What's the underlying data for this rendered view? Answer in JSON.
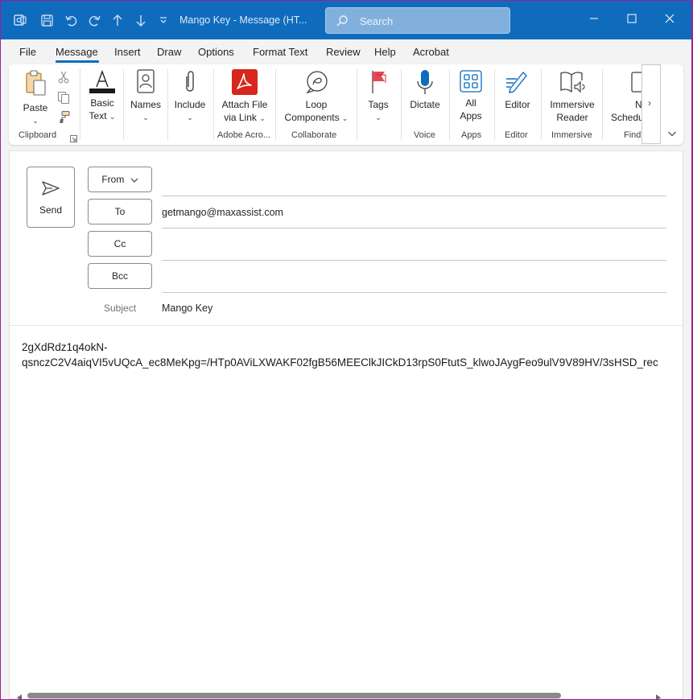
{
  "titlebar": {
    "title": "Mango Key  -  Message (HT...",
    "search_placeholder": "Search"
  },
  "menu": {
    "items": [
      "File",
      "Message",
      "Insert",
      "Draw",
      "Options",
      "Format Text",
      "Review",
      "Help",
      "Acrobat"
    ],
    "active": "Message"
  },
  "ribbon": {
    "clipboard": {
      "paste": "Paste",
      "group": "Clipboard"
    },
    "basic_text": {
      "line1": "Basic",
      "line2": "Text"
    },
    "names": "Names",
    "include": "Include",
    "adobe": {
      "line1": "Attach File",
      "line2": "via Link",
      "group": "Adobe Acro..."
    },
    "collaborate": {
      "line1": "Loop",
      "line2": "Components",
      "group": "Collaborate"
    },
    "tags": "Tags",
    "voice": {
      "dictate": "Dictate",
      "group": "Voice"
    },
    "apps": {
      "line1": "All",
      "line2": "Apps",
      "group": "Apps"
    },
    "editor": {
      "label": "Editor",
      "group": "Editor"
    },
    "immersive": {
      "line1": "Immersive",
      "line2": "Reader",
      "group": "Immersive"
    },
    "find": {
      "line1": "N",
      "line2": "Schedu",
      "group": "Find"
    }
  },
  "compose": {
    "send": "Send",
    "from": "From",
    "to": "To",
    "cc": "Cc",
    "bcc": "Bcc",
    "to_value": "getmango@maxassist.com",
    "subject_label": "Subject",
    "subject_value": "Mango Key",
    "body_line1": "2gXdRdz1q4okN-",
    "body_line2": "qsnczC2V4aiqVI5vUQcA_ec8MeKpg=/HTp0AViLXWAKF02fgB56MEEClkJICkD13rpS0FtutS_klwoJAygFeo9ulV9V89HV/3sHSD_rec"
  },
  "colors": {
    "titlebar": "#0f6cbd",
    "accent": "#0f6cbd",
    "adobe_red": "#d7261b",
    "window_border": "#9b1f9b"
  }
}
